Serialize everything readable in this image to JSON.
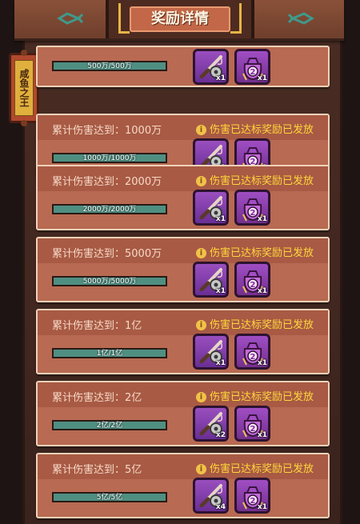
{
  "header": {
    "title": "奖励详情"
  },
  "side_tab": {
    "label": "咸鱼之王"
  },
  "colors": {
    "bar_fill": "#4f8f82",
    "notice": "#ffd73a",
    "card": "#b86a52"
  },
  "rows": [
    {
      "title": "",
      "notice": "",
      "progress": "500万/500万",
      "fill": 1,
      "rewards": [
        {
          "icon": "fishing-rod-icon",
          "qty": "x1"
        },
        {
          "icon": "gift-bag-icon",
          "qty": "x1"
        }
      ]
    },
    {
      "title": "累计伤害达到：1000万",
      "notice": "伤害已达标奖励已发放",
      "progress": "1000万/1000万",
      "fill": 1,
      "rewards": [
        {
          "icon": "fishing-rod-icon",
          "qty": "x1"
        },
        {
          "icon": "gift-bag-icon",
          "qty": "x1"
        }
      ]
    },
    {
      "title": "累计伤害达到：2000万",
      "notice": "伤害已达标奖励已发放",
      "progress": "2000万/2000万",
      "fill": 1,
      "rewards": [
        {
          "icon": "fishing-rod-icon",
          "qty": "x1"
        },
        {
          "icon": "gift-bag-icon",
          "qty": "x1"
        }
      ]
    },
    {
      "title": "累计伤害达到：5000万",
      "notice": "伤害已达标奖励已发放",
      "progress": "5000万/5000万",
      "fill": 1,
      "rewards": [
        {
          "icon": "fishing-rod-icon",
          "qty": "x1"
        },
        {
          "icon": "gift-bag-icon",
          "qty": "x1"
        }
      ]
    },
    {
      "title": "累计伤害达到：1亿",
      "notice": "伤害已达标奖励已发放",
      "progress": "1亿/1亿",
      "fill": 1,
      "rewards": [
        {
          "icon": "fishing-rod-icon",
          "qty": "x1"
        },
        {
          "icon": "gift-bag-icon",
          "qty": "x1"
        }
      ]
    },
    {
      "title": "累计伤害达到：2亿",
      "notice": "伤害已达标奖励已发放",
      "progress": "2亿/2亿",
      "fill": 1,
      "rewards": [
        {
          "icon": "fishing-rod-icon",
          "qty": "x2"
        },
        {
          "icon": "gift-bag-icon",
          "qty": "x1"
        }
      ]
    },
    {
      "title": "累计伤害达到：5亿",
      "notice": "伤害已达标奖励已发放",
      "progress": "5亿/5亿",
      "fill": 1,
      "rewards": [
        {
          "icon": "fishing-rod-icon",
          "qty": "x4"
        },
        {
          "icon": "gift-bag-icon",
          "qty": "x1"
        }
      ]
    }
  ]
}
